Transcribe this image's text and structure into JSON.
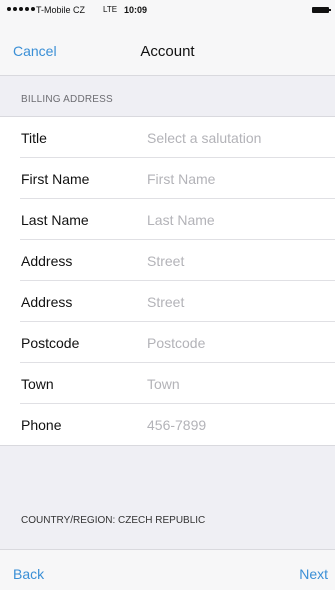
{
  "status_bar": {
    "carrier": "T-Mobile CZ",
    "network": "LTE",
    "time": "10:09",
    "signal_icon": "signal-dots-icon",
    "battery_icon": "battery-icon"
  },
  "nav": {
    "cancel_label": "Cancel",
    "title": "Account"
  },
  "billing_section": {
    "header": "BILLING ADDRESS",
    "rows": [
      {
        "label": "Title",
        "placeholder": "Select a salutation"
      },
      {
        "label": "First Name",
        "placeholder": "First Name"
      },
      {
        "label": "Last Name",
        "placeholder": "Last Name"
      },
      {
        "label": "Address",
        "placeholder": "Street"
      },
      {
        "label": "Address",
        "placeholder": "Street"
      },
      {
        "label": "Postcode",
        "placeholder": "Postcode"
      },
      {
        "label": "Town",
        "placeholder": "Town"
      },
      {
        "label": "Phone",
        "placeholder": "456-7899"
      }
    ]
  },
  "country": {
    "label": "COUNTRY/REGION: CZECH REPUBLIC"
  },
  "toolbar": {
    "back_label": "Back",
    "next_label": "Next"
  },
  "colors": {
    "accent": "#3a8fd6",
    "background": "#efeff4",
    "placeholder": "#b3b3b8"
  }
}
